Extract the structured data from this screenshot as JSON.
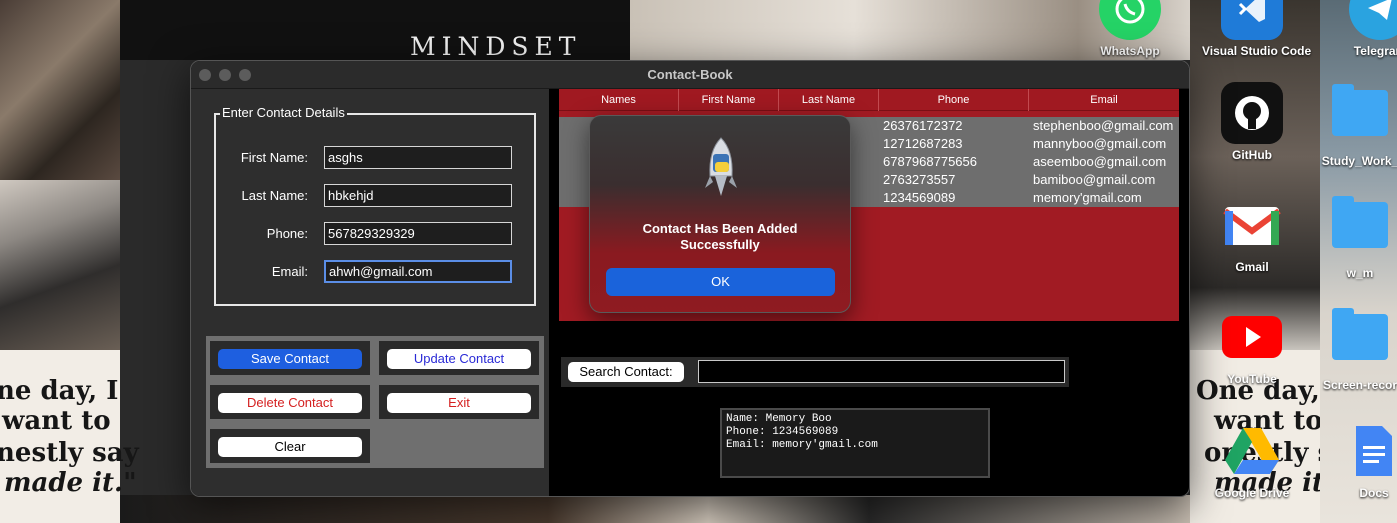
{
  "wallpaper": {
    "mindset_text": "MINDSET",
    "quote_left": [
      "ne day, I",
      "want to",
      "nestly say",
      "made it.\""
    ],
    "quote_right": [
      "One day, I",
      "want to",
      "onestly say",
      "made it.\""
    ]
  },
  "desktop_icons": [
    {
      "label": "WhatsApp",
      "icon": "whatsapp-icon",
      "color": "#25d366"
    },
    {
      "label": "Visual Studio Code",
      "icon": "vscode-icon",
      "color": "#1f7bd8"
    },
    {
      "label": "Telegram",
      "icon": "telegram-icon",
      "color": "#2aa3e0"
    },
    {
      "label": "GitHub",
      "icon": "github-icon",
      "color": "#111111"
    },
    {
      "label": "Study_Work_",
      "icon": "folder-icon",
      "color": "#3fa7f3"
    },
    {
      "label": "Gmail",
      "icon": "gmail-icon",
      "color": "#ffffff"
    },
    {
      "label": "w_m",
      "icon": "folder-icon",
      "color": "#3fa7f3"
    },
    {
      "label": "YouTube",
      "icon": "youtube-icon",
      "color": "#ff0000"
    },
    {
      "label": "Screen-recor",
      "icon": "folder-icon",
      "color": "#3fa7f3"
    },
    {
      "label": "Google Drive",
      "icon": "google-drive-icon",
      "color": "#1fa463"
    },
    {
      "label": "Docs",
      "icon": "docs-icon",
      "color": "#4285f4"
    }
  ],
  "window": {
    "title": "Contact-Book"
  },
  "form": {
    "legend": "Enter Contact Details",
    "first_name_label": "First Name:",
    "first_name_value": "asghs",
    "last_name_label": "Last Name:",
    "last_name_value": "hbkehjd",
    "phone_label": "Phone:",
    "phone_value": "567829329329",
    "email_label": "Email:",
    "email_value": "ahwh@gmail.com"
  },
  "buttons": {
    "save": "Save Contact",
    "update": "Update Contact",
    "delete": "Delete Contact",
    "exit": "Exit",
    "clear": "Clear"
  },
  "table": {
    "columns": [
      "Names",
      "First Name",
      "Last Name",
      "Phone",
      "Email"
    ],
    "rows": [
      {
        "phone": "26376172372",
        "email": "stephenboo@gmail.com"
      },
      {
        "phone": "12712687283",
        "email": "mannyboo@gmail.com"
      },
      {
        "phone": "6787968775656",
        "email": "aseemboo@gmail.com"
      },
      {
        "phone": "2763273557",
        "email": "bamiboo@gmail.com"
      },
      {
        "phone": "1234569089",
        "email": "memory'gmail.com"
      }
    ]
  },
  "search": {
    "button_label": "Search Contact:",
    "value": ""
  },
  "result": {
    "lines": [
      "Name: Memory Boo",
      "Phone: 1234569089",
      "Email: memory'gmail.com"
    ]
  },
  "alert": {
    "message": "Contact Has Been Added Successfully",
    "ok_label": "OK"
  },
  "colors": {
    "table_red": "#a11b23",
    "primary_blue": "#1e5fe0",
    "update_text": "#2a2ad6",
    "danger_text": "#d42020"
  }
}
